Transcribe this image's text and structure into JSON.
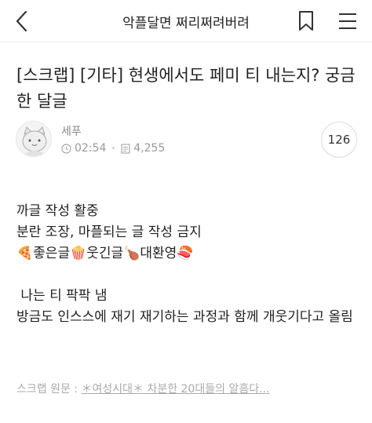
{
  "header": {
    "title": "악플달면 쩌리쩌려버려",
    "back_icon": "chevron-left-icon",
    "bookmark_icon": "bookmark-icon",
    "menu_icon": "hamburger-menu-icon"
  },
  "post": {
    "title": "[스크랩] [기타] 현생에서도 페미 티 내는지? 궁금한 달글",
    "author": "세푸",
    "time": "02:54",
    "views": "4,255",
    "comment_count": "126"
  },
  "body": {
    "line1": "까글 작성 활중",
    "line2": "분란 조장, 마플되는 글 작성 금지",
    "line3": "🍕좋은글🍿웃긴글🍗대환영🍣",
    "line4": " 나는 티 팍팍 냄",
    "line5": "방금도 인스스에 재기 재기하는 과정과 함께 개웃기다고 올림"
  },
  "scrap": {
    "label": "스크랩 원문 : ",
    "link_text": "＊여성시대＊ 차분한 20대들의 알흠다..."
  }
}
